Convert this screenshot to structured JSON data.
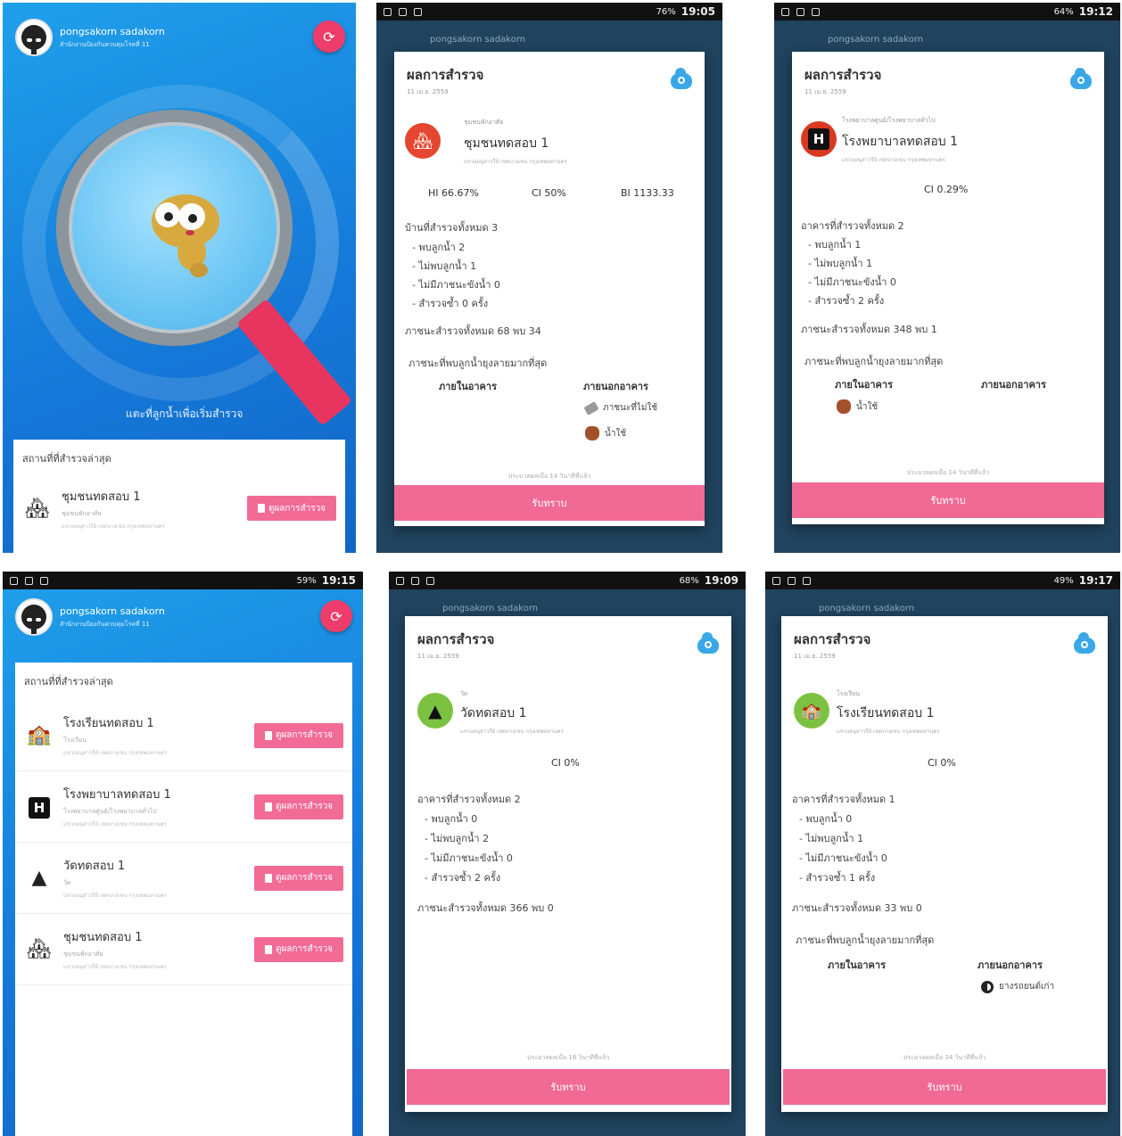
{
  "user": {
    "name": "pongsakorn sadakorn",
    "org": "สำนักงานป้องกันควบคุมโรคที่ 11"
  },
  "statusbar": {
    "s2_time": "19:05",
    "s2_batt": "76%",
    "s3_time": "19:12",
    "s3_batt": "64%",
    "s4_time": "19:15",
    "s4_batt": "59%",
    "s5_time": "19:09",
    "s5_batt": "68%",
    "s6_time": "19:17",
    "s6_batt": "49%"
  },
  "home": {
    "hint": "แตะที่ลูกน้ำเพื่อเริ่มสำรวจ",
    "recent_title": "สถานที่ที่สำรวจล่าสุด",
    "result_button": "ดูผลการสำรวจ"
  },
  "places": {
    "community": {
      "name": "ชุมชนทดสอบ 1",
      "type": "ชุมชนพักอาศัย",
      "addr": "แขวงอนุสาวรีย์ เขตบางเขน กรุงเทพมหานคร"
    },
    "school": {
      "name": "โรงเรียนทดสอบ 1",
      "type": "โรงเรียน",
      "addr": "แขวงอนุสาวรีย์ เขตบางเขน กรุงเทพมหานคร"
    },
    "hospital": {
      "name": "โรงพยาบาลทดสอบ 1",
      "type": "โรงพยาบาลศูนย์/โรงพยาบาลทั่วไป",
      "addr": "แขวงอนุสาวรีย์ เขตบางเขน กรุงเทพมหานคร"
    },
    "temple": {
      "name": "วัดทดสอบ 1",
      "type": "วัด",
      "addr": "แขวงอนุสาวรีย์ เขตบางเขน กรุงเทพมหานคร"
    }
  },
  "dialog": {
    "title": "ผลการสำรวจ",
    "date": "11 เม.ย. 2559",
    "ack": "รับทราบ",
    "most_found": "ภาชนะที่พบลูกน้ำยุงลายมากที่สุด",
    "indoor": "ภายในอาคาร",
    "outdoor": "ภายนอกอาคาร"
  },
  "r_community": {
    "hi": "HI 66.67%",
    "ci": "CI 50%",
    "bi": "BI 1133.33",
    "total": "บ้านที่สำรวจทั้งหมด 3",
    "found": "- พบลูกน้ำ 2",
    "notfound": "- ไม่พบลูกน้ำ 1",
    "nocontainer": "- ไม่มีภาชนะขังน้ำ 0",
    "repeat": "- สำรวจซ้ำ 0 ครั้ง",
    "containers": "ภาชนะสำรวจทั้งหมด 68 พบ 34",
    "out1": "ภาชนะที่ไม่ใช้",
    "out2": "น้ำใช้",
    "updated": "ประมวลผลเมื่อ 14 วินาทีที่แล้ว"
  },
  "r_hospital": {
    "ci": "CI 0.29%",
    "total": "อาคารที่สำรวจทั้งหมด 2",
    "found": "- พบลูกน้ำ 1",
    "notfound": "- ไม่พบลูกน้ำ 1",
    "nocontainer": "- ไม่มีภาชนะขังน้ำ 0",
    "repeat": "- สำรวจซ้ำ 2 ครั้ง",
    "containers": "ภาชนะสำรวจทั้งหมด 348 พบ 1",
    "in1": "น้ำใช้",
    "updated": "ประมวลผลเมื่อ 14 วินาทีที่แล้ว"
  },
  "r_temple": {
    "ci": "CI 0%",
    "total": "อาคารที่สำรวจทั้งหมด 2",
    "found": "- พบลูกน้ำ 0",
    "notfound": "- ไม่พบลูกน้ำ 2",
    "nocontainer": "- ไม่มีภาชนะขังน้ำ 0",
    "repeat": "- สำรวจซ้ำ 2 ครั้ง",
    "containers": "ภาชนะสำรวจทั้งหมด 366 พบ 0",
    "updated": "ประมวลผลเมื่อ 16 วินาทีที่แล้ว"
  },
  "r_school": {
    "ci": "CI 0%",
    "total": "อาคารที่สำรวจทั้งหมด 1",
    "found": "- พบลูกน้ำ 0",
    "notfound": "- ไม่พบลูกน้ำ 1",
    "nocontainer": "- ไม่มีภาชนะขังน้ำ 0",
    "repeat": "- สำรวจซ้ำ 1 ครั้ง",
    "containers": "ภาชนะสำรวจทั้งหมด 33 พบ 0",
    "out1": "ยางรถยนต์เก่า",
    "updated": "ประมวลผลเมื่อ 34 วินาทีที่แล้ว"
  },
  "colors": {
    "primary_blue": "#1b8de0",
    "accent_pink": "#f06a94",
    "fab_red": "#ee3d6a",
    "community_red": "#e5462f",
    "temple_green": "#7cc242"
  }
}
